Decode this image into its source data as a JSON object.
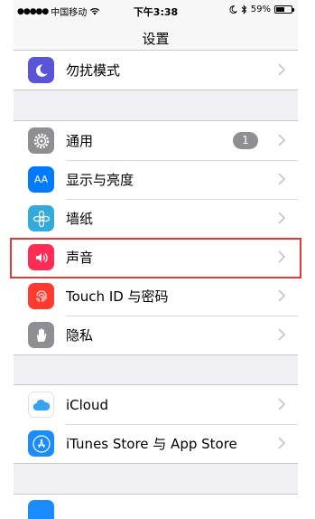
{
  "status_bar": {
    "signal_dots": "●●●●●",
    "carrier": "中国移动",
    "wifi_icon": "wifi-icon",
    "time": "下午3:38",
    "battery_percent": "59%",
    "battery_level": 0.59
  },
  "nav": {
    "title": "设置"
  },
  "groups": [
    {
      "rows": [
        {
          "label": "勿扰模式",
          "icon": "moon-icon",
          "icon_color": "#5856d6"
        }
      ]
    },
    {
      "rows": [
        {
          "label": "通用",
          "icon": "gear-icon",
          "icon_color": "#8e8e93",
          "badge": "1"
        },
        {
          "label": "显示与亮度",
          "icon": "text-size-icon",
          "icon_color": "#007aff",
          "icon_text": "AA"
        },
        {
          "label": "墙纸",
          "icon": "flower-icon",
          "icon_color": "#34aadc"
        },
        {
          "label": "声音",
          "icon": "speaker-icon",
          "icon_color": "#ff2d55",
          "highlighted": true
        },
        {
          "label": "Touch ID 与密码",
          "icon": "fingerprint-icon",
          "icon_color": "#ff3b30"
        },
        {
          "label": "隐私",
          "icon": "hand-icon",
          "icon_color": "#8e8e93"
        }
      ]
    },
    {
      "rows": [
        {
          "label": "iCloud",
          "icon": "cloud-icon",
          "icon_color": "#ffffff"
        },
        {
          "label": "iTunes Store 与 App Store",
          "icon": "app-store-icon",
          "icon_color": "#1a8cff"
        }
      ]
    }
  ],
  "colors": {
    "highlight_border": "#e03a3a",
    "background": "#efeff4"
  }
}
